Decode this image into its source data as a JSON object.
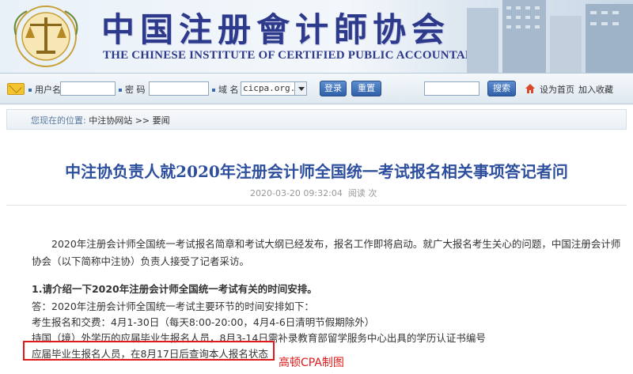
{
  "header": {
    "title_cn": "中国注册會计師协会",
    "title_en": "THE CHINESE INSTITUTE OF CERTIFIED PUBLIC ACCOUNTANTS",
    "emblem_text": "中国注册会计师协会"
  },
  "loginbar": {
    "username_label": "用户名",
    "username_value": "",
    "password_label": "密 码",
    "password_value": "",
    "domain_label": "域 名",
    "domain_value": "cicpa.org.cn",
    "login_button": "登录",
    "reset_button": "重置",
    "search_value": "",
    "search_button": "搜索",
    "homepage_link": "设为首页",
    "favorite_link": "加入收藏"
  },
  "breadcrumb": {
    "label": "您现在的位置:",
    "trail": "中注协网站 >> 要闻"
  },
  "article": {
    "title": "中注协负责人就2020年注册会计师全国统一考试报名相关事项答记者问",
    "datetime": "2020-03-20 09:32:04",
    "read_label": "阅读",
    "read_unit": "次",
    "intro_line1": "2020年注册会计师全国统一考试报名简章和考试大纲已经发布，报名工作即将启动。就广大报名考生关心的问题，中国注册会计师",
    "intro_line2": "协会（以下简称中注协）负责人接受了记者采访。",
    "question1": "1.请介绍一下2020年注册会计师全国统一考试有关的时间安排。",
    "answer_line1": "答：2020年注册会计师全国统一考试主要环节的时间安排如下：",
    "answer_line2": "考生报名和交费：4月1-30日（每天8:00-20:00，4月4-6日清明节假期除外）",
    "answer_line3": "持国（境）外学历的应届毕业生报名人员，8月3-14日需补录教育部留学服务中心出具的学历认证书编号",
    "answer_line4": "应届毕业生报名人员，在8月17日后查询本人报名状态"
  },
  "annotation": {
    "watermark": "高顿CPA制图"
  },
  "colors": {
    "title_blue": "#2d4f9e",
    "banner_blue": "#2d3a8c",
    "button_blue": "#2e5fa8",
    "highlight_red": "#e01a1a"
  },
  "icons": [
    "mail-icon",
    "emblem-icon",
    "home-icon",
    "select-arrow-icon"
  ]
}
